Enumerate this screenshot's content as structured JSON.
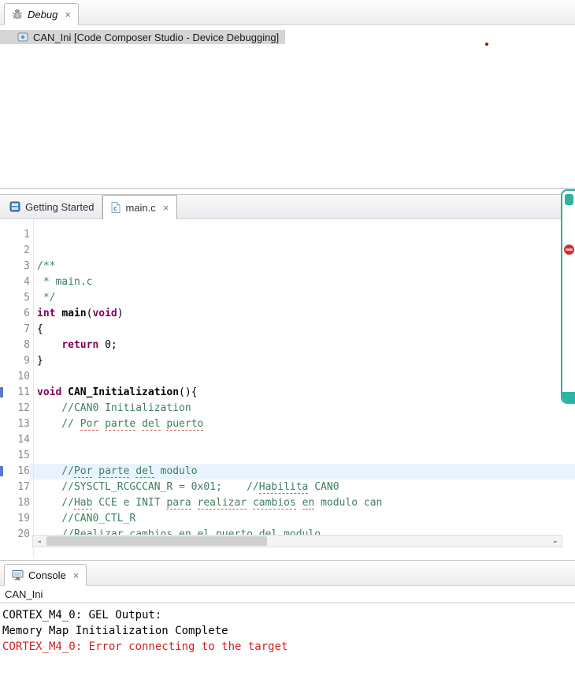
{
  "icons": {
    "close_glyph": "×",
    "scroll_left_glyph": "◄",
    "scroll_right_glyph": "►"
  },
  "debug_view": {
    "tab_label": "Debug",
    "session": "CAN_Ini [Code Composer Studio - Device Debugging]"
  },
  "editor": {
    "tabs": [
      {
        "label": "Getting Started"
      },
      {
        "label": "main.c"
      }
    ],
    "current_line": 16,
    "code_lines": [
      {
        "num": 1,
        "tokens": []
      },
      {
        "num": 2,
        "tokens": []
      },
      {
        "num": 3,
        "tokens": [
          {
            "t": "/**",
            "c": "comment"
          }
        ]
      },
      {
        "num": 4,
        "tokens": [
          {
            "t": " * main.c",
            "c": "comment"
          }
        ]
      },
      {
        "num": 5,
        "tokens": [
          {
            "t": " */",
            "c": "comment"
          }
        ]
      },
      {
        "num": 6,
        "tokens": [
          {
            "t": "int",
            "c": "keyword"
          },
          {
            "t": " ",
            "c": "plain"
          },
          {
            "t": "main",
            "c": "func"
          },
          {
            "t": "(",
            "c": "plain"
          },
          {
            "t": "void",
            "c": "keyword"
          },
          {
            "t": ")",
            "c": "plain"
          }
        ]
      },
      {
        "num": 7,
        "tokens": [
          {
            "t": "{",
            "c": "plain"
          }
        ]
      },
      {
        "num": 8,
        "tokens": [
          {
            "t": "    ",
            "c": "plain"
          },
          {
            "t": "return",
            "c": "keyword"
          },
          {
            "t": " 0;",
            "c": "plain"
          }
        ]
      },
      {
        "num": 9,
        "tokens": [
          {
            "t": "}",
            "c": "plain"
          }
        ]
      },
      {
        "num": 10,
        "tokens": []
      },
      {
        "num": 11,
        "marker": true,
        "tokens": [
          {
            "t": "void",
            "c": "keyword"
          },
          {
            "t": " ",
            "c": "plain"
          },
          {
            "t": "CAN_Initialization",
            "c": "func"
          },
          {
            "t": "(){",
            "c": "plain"
          }
        ]
      },
      {
        "num": 12,
        "tokens": [
          {
            "t": "    //CAN0 Initialization",
            "c": "comment"
          }
        ]
      },
      {
        "num": 13,
        "tokens": [
          {
            "t": "    // ",
            "c": "comment"
          },
          {
            "t": "Por",
            "c": "comment",
            "u": true
          },
          {
            "t": " ",
            "c": "comment"
          },
          {
            "t": "parte",
            "c": "comment",
            "u": true
          },
          {
            "t": " ",
            "c": "comment"
          },
          {
            "t": "del",
            "c": "comment",
            "u": true
          },
          {
            "t": " ",
            "c": "comment"
          },
          {
            "t": "puerto",
            "c": "comment",
            "u": true
          }
        ]
      },
      {
        "num": 14,
        "tokens": []
      },
      {
        "num": 15,
        "tokens": []
      },
      {
        "num": 16,
        "marker": true,
        "tokens": [
          {
            "t": "    //",
            "c": "comment"
          },
          {
            "t": "Por",
            "c": "comment",
            "u": true
          },
          {
            "t": " ",
            "c": "comment"
          },
          {
            "t": "parte",
            "c": "comment",
            "u": true
          },
          {
            "t": " ",
            "c": "comment"
          },
          {
            "t": "del",
            "c": "comment",
            "u": true
          },
          {
            "t": " modulo",
            "c": "comment"
          }
        ]
      },
      {
        "num": 17,
        "tokens": [
          {
            "t": "    //SYSCTL_RCGCCAN_R = 0x01;    //",
            "c": "comment"
          },
          {
            "t": "Habilita",
            "c": "comment",
            "u": true
          },
          {
            "t": " CAN0",
            "c": "comment"
          }
        ]
      },
      {
        "num": 18,
        "tokens": [
          {
            "t": "    //",
            "c": "comment"
          },
          {
            "t": "Hab",
            "c": "comment",
            "u": true
          },
          {
            "t": " CCE e INIT ",
            "c": "comment"
          },
          {
            "t": "para",
            "c": "comment",
            "u": true
          },
          {
            "t": " ",
            "c": "comment"
          },
          {
            "t": "realizar",
            "c": "comment",
            "u": true
          },
          {
            "t": " ",
            "c": "comment"
          },
          {
            "t": "cambios",
            "c": "comment",
            "u": true
          },
          {
            "t": " ",
            "c": "comment"
          },
          {
            "t": "en",
            "c": "comment",
            "u": true
          },
          {
            "t": " modulo can",
            "c": "comment"
          }
        ]
      },
      {
        "num": 19,
        "tokens": [
          {
            "t": "    //CAN0_CTL_R",
            "c": "comment"
          }
        ]
      },
      {
        "num": 20,
        "tokens": [
          {
            "t": "    //Realizar cambios en el puerto del modulo",
            "c": "comment"
          }
        ]
      }
    ]
  },
  "console": {
    "tab_label": "Console",
    "title": "CAN_Ini",
    "lines": [
      {
        "text": "CORTEX_M4_0: GEL Output:",
        "error": false
      },
      {
        "text": "Memory Map Initialization Complete",
        "error": false
      },
      {
        "text": "CORTEX_M4_0: Error connecting to the target",
        "error": true
      }
    ]
  },
  "colors": {
    "comment": "#3F7F5F",
    "keyword": "#7F0055",
    "current_line_bg": "#E9F3FE",
    "error_text": "#CC2222",
    "popup_accent": "#2BB3A3"
  }
}
